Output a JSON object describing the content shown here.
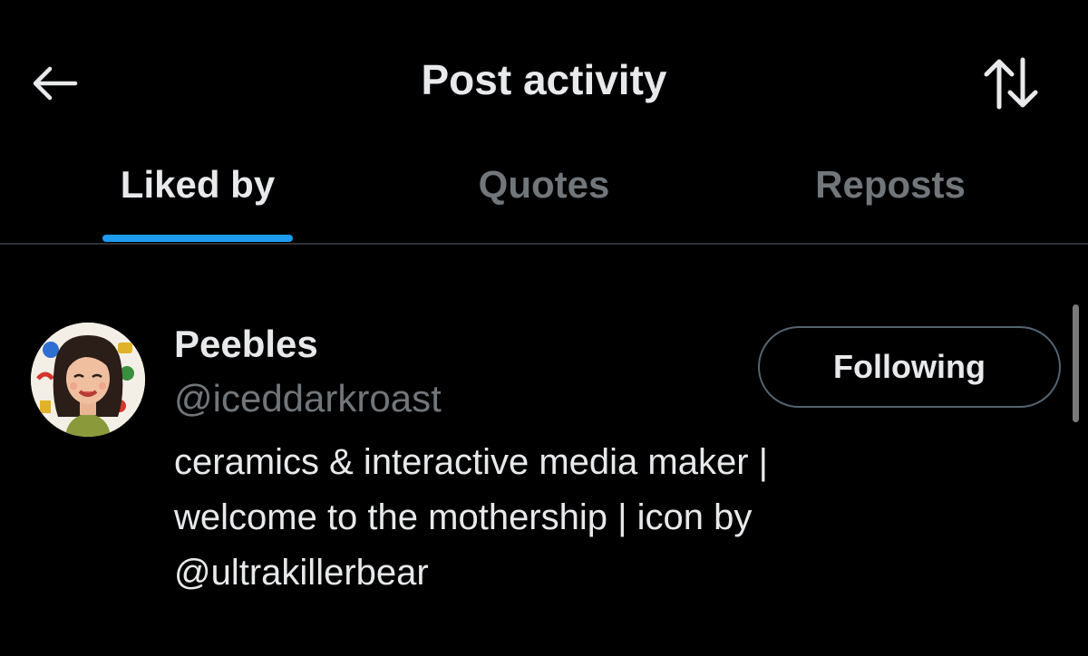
{
  "header": {
    "title": "Post activity",
    "back_icon": "arrow-left-icon",
    "sort_icon": "sort-arrows-icon"
  },
  "tabs": [
    {
      "label": "Liked by",
      "active": true
    },
    {
      "label": "Quotes",
      "active": false
    },
    {
      "label": "Reposts",
      "active": false
    }
  ],
  "users": [
    {
      "display_name": "Peebles",
      "handle": "@iceddarkroast",
      "bio_lines": [
        "ceramics & interactive media maker |",
        "welcome to the mothership | icon by",
        "@ultrakillerbear"
      ],
      "follow_label": "Following"
    }
  ],
  "colors": {
    "background": "#000000",
    "primary_text": "#e7e9ea",
    "secondary_text": "#71767b",
    "accent": "#1d9bf0",
    "divider": "#2f3336",
    "button_border": "#536471"
  }
}
